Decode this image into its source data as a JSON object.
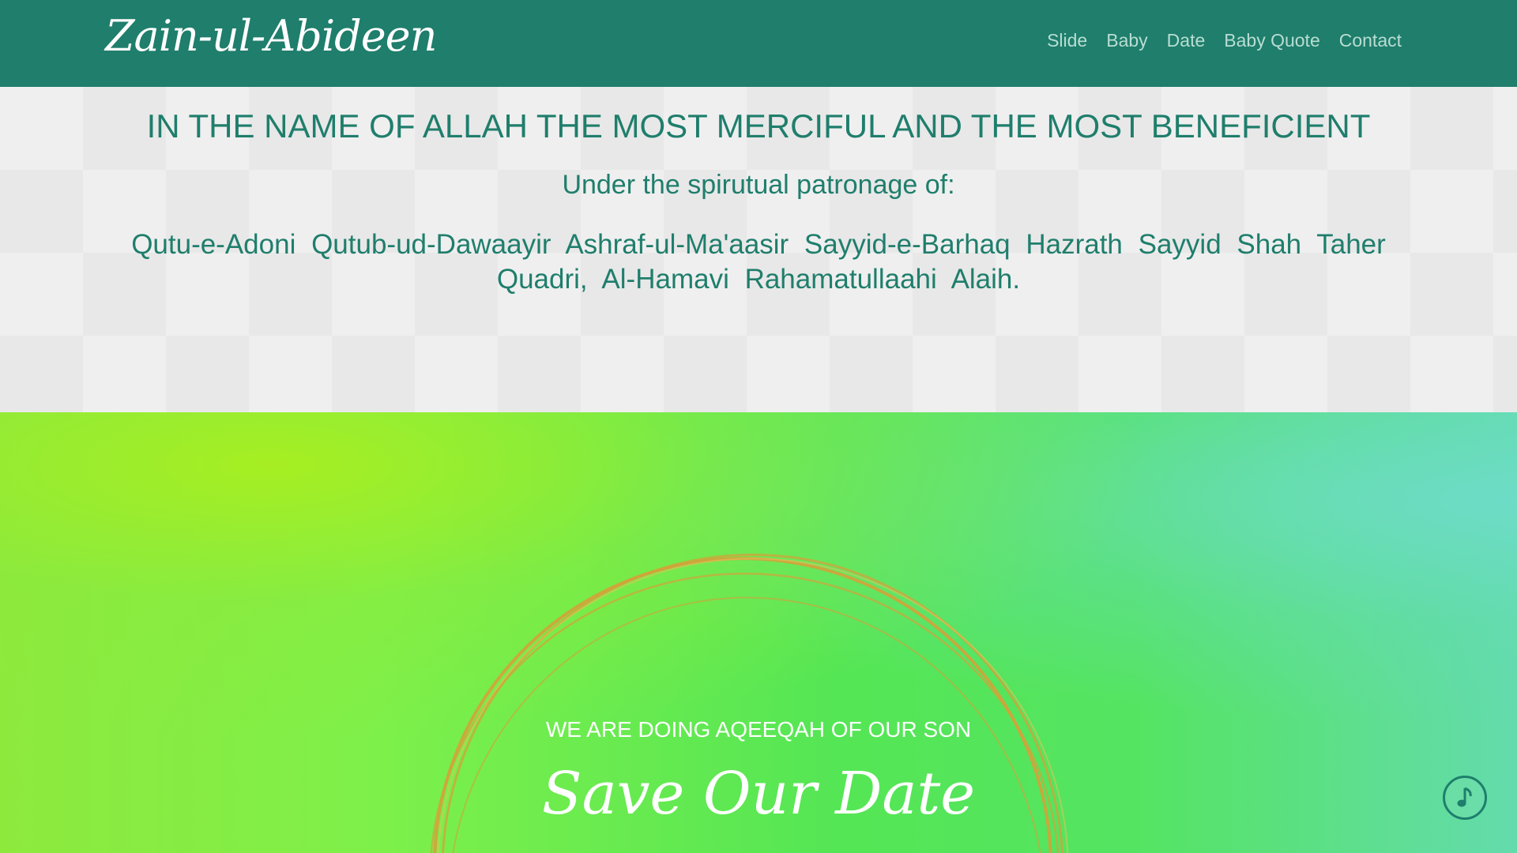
{
  "header": {
    "brand": "Zain-ul-Abideen",
    "nav": [
      "Slide",
      "Baby",
      "Date",
      "Baby Quote",
      "Contact"
    ]
  },
  "patronage": {
    "headline": "IN THE NAME OF ALLAH THE MOST MERCIFUL AND THE MOST BENEFICIENT",
    "subhead": "Under the spirutual patronage of:",
    "names": "Qutu-e-Adoni Qutub-ud-Dawaayir Ashraf-ul-Ma'aasir Sayyid-e-Barhaq Hazrath Sayyid Shah Taher Quadri, Al-Hamavi Rahamatullaahi Alaih."
  },
  "hero": {
    "announcement": "WE ARE DOING AQEEQAH OF OUR SON",
    "title": "Save Our Date"
  },
  "icons": {
    "music_toggle": "music-note-icon"
  },
  "colors": {
    "brand_teal": "#1f7e6c",
    "nav_link": "#b9ddd2",
    "ring_gold": "#d4a23a"
  }
}
